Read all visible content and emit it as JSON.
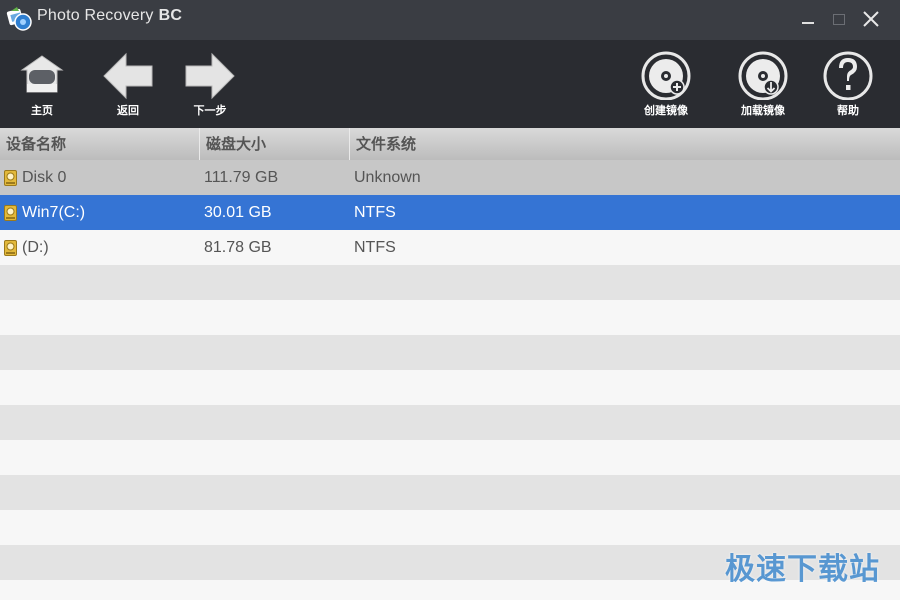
{
  "window": {
    "title": "Photo Recovery",
    "title_suffix": "BC"
  },
  "toolbar": {
    "home_label": "主页",
    "back_label": "返回",
    "next_label": "下一步",
    "create_image_label": "创建镜像",
    "load_image_label": "加载镜像",
    "help_label": "帮助"
  },
  "table": {
    "headers": [
      "设备名称",
      "磁盘大小",
      "文件系统"
    ],
    "rows": [
      {
        "name": "Disk 0",
        "size": "111.79 GB",
        "fs": "Unknown"
      },
      {
        "name": "Win7(C:)",
        "size": "30.01 GB",
        "fs": "NTFS"
      },
      {
        "name": "(D:)",
        "size": "81.78 GB",
        "fs": "NTFS"
      }
    ],
    "selected_row": 1
  },
  "watermark": "极速下载站",
  "colors": {
    "titlebar": "#3a3d43",
    "toolbar": "#2a2c31",
    "selection": "#3574d4",
    "watermark": "#4a8fd0"
  }
}
